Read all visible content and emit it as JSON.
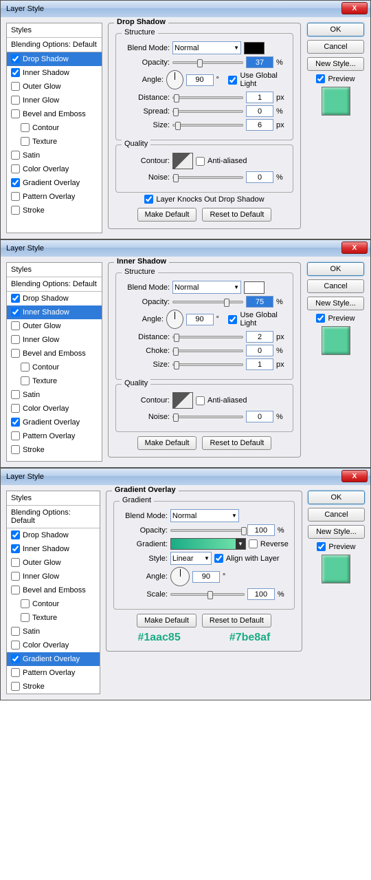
{
  "title": "Layer Style",
  "buttons": {
    "ok": "OK",
    "cancel": "Cancel",
    "newstyle": "New Style...",
    "preview": "Preview",
    "makedef": "Make Default",
    "reset": "Reset to Default"
  },
  "styles": {
    "header": "Styles",
    "blending": "Blending Options: Default",
    "items": [
      "Drop Shadow",
      "Inner Shadow",
      "Outer Glow",
      "Inner Glow",
      "Bevel and Emboss",
      "Contour",
      "Texture",
      "Satin",
      "Color Overlay",
      "Gradient Overlay",
      "Pattern Overlay",
      "Stroke"
    ]
  },
  "d1": {
    "legend": "Drop Shadow",
    "structure": "Structure",
    "quality": "Quality",
    "blendmode": "Blend Mode:",
    "blendval": "Normal",
    "opacity": "Opacity:",
    "opval": "37",
    "pct": "%",
    "angle": "Angle:",
    "angval": "90",
    "deg": "°",
    "global": "Use Global Light",
    "distance": "Distance:",
    "distval": "1",
    "px": "px",
    "spread": "Spread:",
    "spreadval": "0",
    "size": "Size:",
    "sizeval": "6",
    "contour": "Contour:",
    "aa": "Anti-aliased",
    "noise": "Noise:",
    "noiseval": "0",
    "knock": "Layer Knocks Out Drop Shadow"
  },
  "d2": {
    "legend": "Inner Shadow",
    "structure": "Structure",
    "quality": "Quality",
    "blendmode": "Blend Mode:",
    "blendval": "Normal",
    "opacity": "Opacity:",
    "opval": "75",
    "pct": "%",
    "angle": "Angle:",
    "angval": "90",
    "deg": "°",
    "global": "Use Global Light",
    "distance": "Distance:",
    "distval": "2",
    "px": "px",
    "choke": "Choke:",
    "chokeval": "0",
    "size": "Size:",
    "sizeval": "1",
    "contour": "Contour:",
    "aa": "Anti-aliased",
    "noise": "Noise:",
    "noiseval": "0"
  },
  "d3": {
    "legend": "Gradient Overlay",
    "gradient": "Gradient",
    "blendmode": "Blend Mode:",
    "blendval": "Normal",
    "opacity": "Opacity:",
    "opval": "100",
    "pct": "%",
    "gradlabel": "Gradient:",
    "reverse": "Reverse",
    "style": "Style:",
    "styleval": "Linear",
    "align": "Align with Layer",
    "angle": "Angle:",
    "angval": "90",
    "deg": "°",
    "scale": "Scale:",
    "scaleval": "100",
    "c1": "#1aac85",
    "c2": "#7be8af"
  }
}
